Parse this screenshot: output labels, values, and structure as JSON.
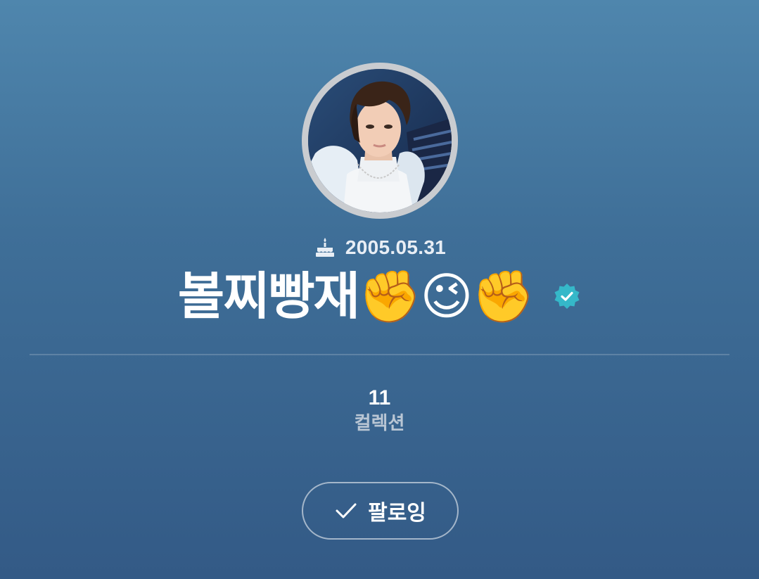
{
  "profile": {
    "birthday": "2005.05.31",
    "name": "볼찌빵재✊😉✊",
    "verified": true,
    "birthday_icon": "cake-icon",
    "verified_icon": "verified-badge-icon"
  },
  "stats": {
    "collections": {
      "value": "11",
      "label": "컬렉션"
    }
  },
  "follow_button": {
    "label": "팔로잉",
    "icon": "checkmark-icon"
  },
  "colors": {
    "background_top": "#4f86ad",
    "background_bottom": "#335a86",
    "avatar_ring": "#c9ccd0",
    "verified_badge": "#35b8c9",
    "stat_label": "#b9c6d4"
  }
}
